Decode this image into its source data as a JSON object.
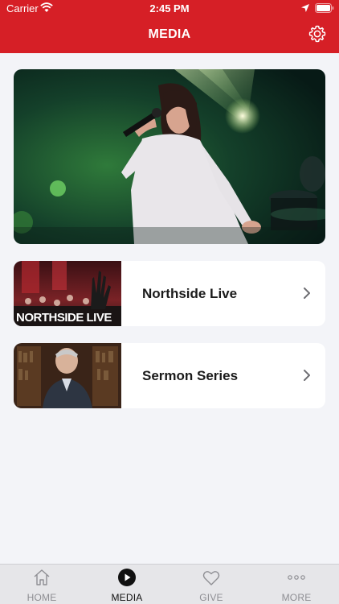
{
  "status_bar": {
    "carrier": "Carrier",
    "time": "2:45 PM"
  },
  "nav": {
    "title": "MEDIA",
    "settings_icon": "gear-icon"
  },
  "hero": {
    "image": "concert-singer-photo"
  },
  "cards": [
    {
      "label": "Northside Live",
      "thumb_text": "NORTHSIDE LIVE",
      "thumb_image": "worship-crowd-photo"
    },
    {
      "label": "Sermon Series",
      "thumb_image": "pastor-portrait-photo"
    }
  ],
  "tabs": [
    {
      "label": "HOME",
      "icon": "home-icon",
      "active": false
    },
    {
      "label": "MEDIA",
      "icon": "play-icon",
      "active": true
    },
    {
      "label": "GIVE",
      "icon": "heart-icon",
      "active": false
    },
    {
      "label": "MORE",
      "icon": "more-icon",
      "active": false
    }
  ],
  "colors": {
    "brand": "#d61f26",
    "background": "#f3f4f8",
    "tab_bar": "#e6e6e9"
  }
}
